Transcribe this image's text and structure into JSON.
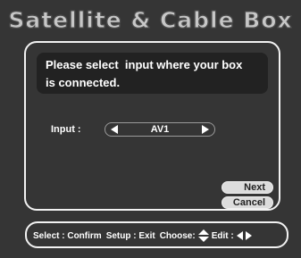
{
  "title": "Satellite & Cable Box",
  "message": {
    "line1": "Please select  input where your box",
    "line2": "is connected."
  },
  "input": {
    "label": "Input :",
    "value": "AV1"
  },
  "buttons": {
    "next": "Next",
    "cancel": "Cancel"
  },
  "statusbar": {
    "select": "Select : Confirm",
    "setup": "Setup : Exit",
    "choose": "Choose:",
    "edit": "Edit :"
  },
  "icons": {
    "input_prev": "triangle-left-icon",
    "input_next": "triangle-right-icon",
    "choose": "up-down-arrows-icon",
    "edit": "left-right-arrows-icon"
  }
}
